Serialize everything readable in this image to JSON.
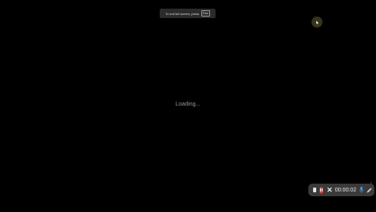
{
  "fullscreen_banner": {
    "text": "To exit full screen, press",
    "key": "Esc"
  },
  "status": {
    "loading_text": "Loading..."
  },
  "recorder": {
    "timer": "00:00:02",
    "close_glyph": "×",
    "discard_glyph": "✕",
    "icons": {
      "stop": "stop-icon",
      "pause": "pause-icon",
      "discard": "discard-icon",
      "mic": "microphone-icon",
      "pen": "pen-icon"
    },
    "colors": {
      "pause_bg": "#d23f3f",
      "mic": "#4aa3ff",
      "bar_bg": "#3a3a3a"
    }
  },
  "cursor": {
    "icon": "mouse-pointer-icon",
    "highlight_color": "#ffe66e"
  }
}
